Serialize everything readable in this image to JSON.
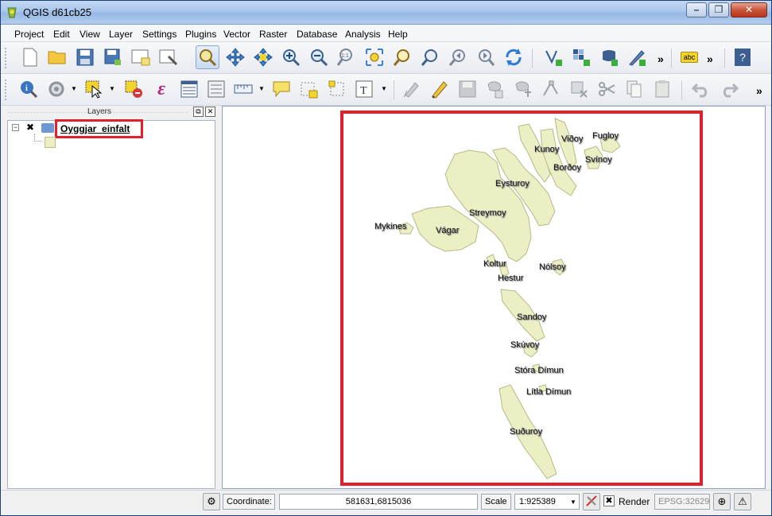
{
  "window": {
    "title": "QGIS d61cb25"
  },
  "menu": [
    "Project",
    "Edit",
    "View",
    "Layer",
    "Settings",
    "Plugins",
    "Vector",
    "Raster",
    "Database",
    "Analysis",
    "Help"
  ],
  "toolbar1": {
    "tools": [
      "new-project-icon",
      "open-project-icon",
      "save-project-icon",
      "save-as-icon",
      "new-print-composer-icon",
      "composer-manager-icon",
      "pan-map-icon",
      "pan-to-selection-icon",
      "pan-icon-alt",
      "zoom-in-icon",
      "zoom-out-icon",
      "zoom-actual-icon",
      "zoom-full-icon",
      "zoom-to-selection-icon",
      "zoom-to-layer-icon",
      "zoom-last-icon",
      "zoom-next-icon",
      "refresh-icon",
      "digitize-icon",
      "raster-icon",
      "python-icon",
      "plugin-icon"
    ],
    "more": "»",
    "label_tool": "abc",
    "help": "?"
  },
  "toolbar2": {
    "tools": [
      "identify-icon",
      "select-tool-icon",
      "select-features-icon",
      "deselect-icon",
      "expression-select-icon",
      "attribute-table-icon",
      "field-calculator-icon",
      "measure-icon",
      "map-tips-icon",
      "new-bookmark-icon",
      "show-bookmarks-icon",
      "text-annotation-icon",
      "edit-icon",
      "pencil-icon",
      "save-edits-icon",
      "add-feature-icon",
      "move-feature-icon",
      "node-tool-icon",
      "delete-selected-icon",
      "cut-features-icon",
      "copy-features-icon",
      "paste-features-icon",
      "undo-icon",
      "redo-icon"
    ],
    "more": "»"
  },
  "layers_panel": {
    "title": "Layers",
    "layer_name": "Oyggjar_einfalt",
    "checked": true
  },
  "map": {
    "labels": [
      "Fugloy",
      "Viðoy",
      "Kunoy",
      "Svínoy",
      "Borðoy",
      "Eysturoy",
      "Streymoy",
      "Mykines",
      "Vágar",
      "Koltur",
      "Nólsoy",
      "Hestur",
      "Sandoy",
      "Skúvoy",
      "Stóra Dímun",
      "Lítla Dímun",
      "Suðuroy"
    ],
    "land_color": "#eceec4",
    "highlight_color": "#e0202a"
  },
  "statusbar": {
    "coordinate_label": "Coordinate:",
    "coordinate_value": "581631,6815036",
    "scale_label": "Scale",
    "scale_value": "1:925389",
    "render_label": "Render",
    "crs": "EPSG:32629"
  }
}
